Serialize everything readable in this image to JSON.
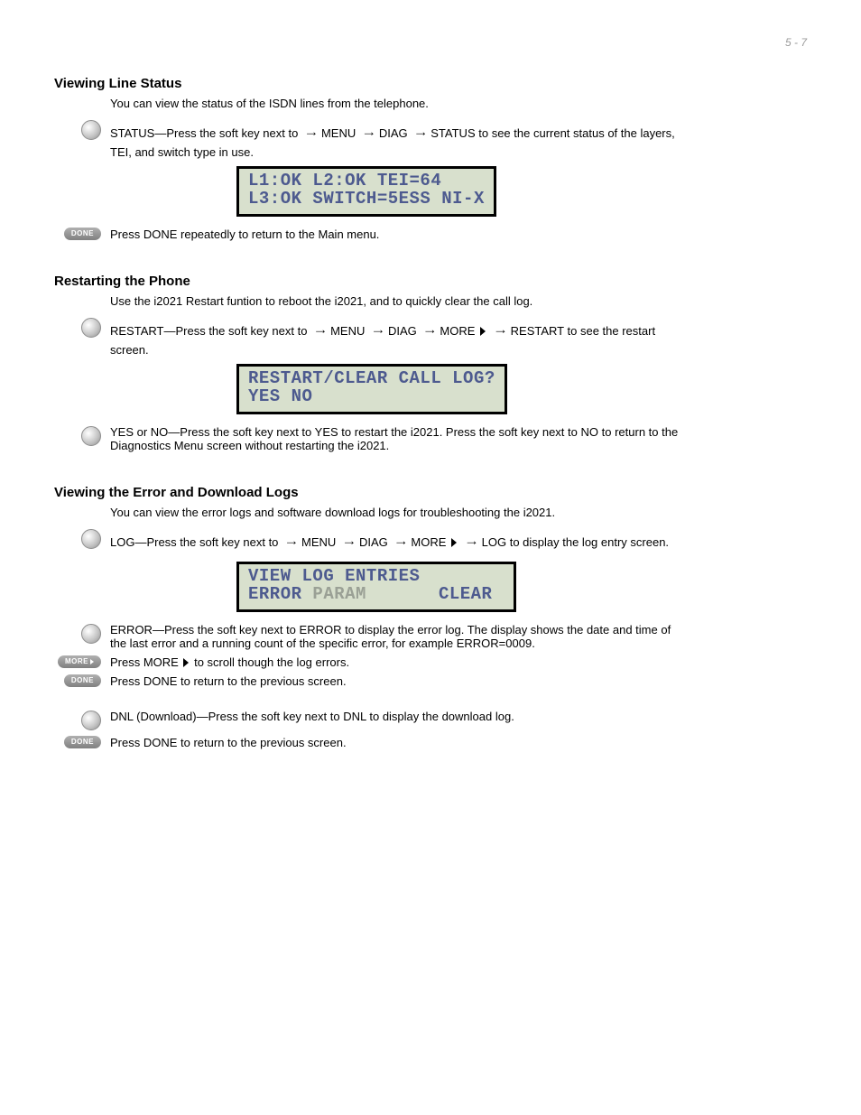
{
  "page_number": "5 - 7",
  "line_status": {
    "title": "Viewing Line Status",
    "intro": "You can view the status of the ISDN lines from the telephone.",
    "step1_prefix": "STATUS—Press the soft key next to",
    "step1_path1": "MENU",
    "step1_path2": "DIAG",
    "step1_path3": "STATUS",
    "step1_suffix": "to see the current status of the layers, TEI, and switch type in use.",
    "lcd_l1": "L1:OK   L2:OK   TEI=64",
    "lcd_l2": "L3:OK   SWITCH=5ESS NI-X",
    "done_text": "Press DONE repeatedly to return to the Main menu."
  },
  "restart": {
    "title": "Restarting the Phone",
    "intro": "Use the i2021 Restart funtion to reboot the i2021, and to quickly clear the call log.",
    "step1_prefix": "RESTART—Press the soft key next to",
    "step1_path1": "MENU",
    "step1_path2": "DIAG",
    "step1_path3": "MORE",
    "step1_path4": "RESTART",
    "step1_suffix": "to see the restart screen.",
    "lcd_l1": "RESTART/CLEAR CALL LOG?",
    "lcd_l2": " YES    NO",
    "step2_prefix": "YES or NO—Press the soft key next to",
    "step2_yes": "YES",
    "step2_mid": "to restart the i2021. Press the soft key next to",
    "step2_no": "NO",
    "step2_suffix": "to return to the Diagnostics Menu screen without restarting the i2021."
  },
  "log": {
    "title": "Viewing the Error and Download Logs",
    "intro": "You can view the error logs and software download logs for troubleshooting the i2021.",
    "step1_prefix": "LOG—Press the soft key next to",
    "step1_path1": "MENU",
    "step1_path2": "DIAG",
    "step1_path3": "MORE",
    "step1_path4": "LOG",
    "step1_suffix": "to display the log entry screen.",
    "lcd_l1": "VIEW LOG ENTRIES",
    "lcd_l2a": "ERROR",
    "lcd_l2b": "PARAM",
    "lcd_l2c": "CLEAR",
    "step2_prefix": "ERROR—Press the soft key next to",
    "step2_err": "ERROR",
    "step2_mid": "to display the error log. The display shows the date and time of the last error and a running count of the specific error, for example",
    "step2_example": "ERROR=0009",
    "more_prefix": "Press MORE",
    "more_suffix": "to scroll though the log errors.",
    "done1": "Press DONE to return to the previous screen."
  },
  "dnl": {
    "step1_prefix": "DNL (Download)—Press the soft key next to",
    "step1_dnl": "DNL",
    "step1_suffix": "to display the download log.",
    "done1": "Press DONE to return to the previous screen."
  }
}
